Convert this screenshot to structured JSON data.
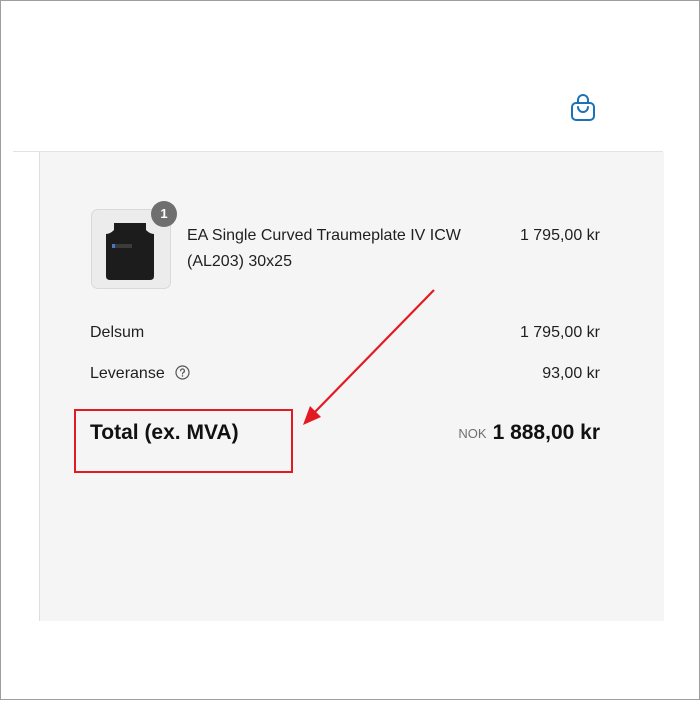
{
  "header": {
    "cart_icon": "shopping-bag-icon",
    "accent_color": "#1a73b8"
  },
  "order_summary": {
    "line_items": [
      {
        "thumbnail_icon": "armor-plate-image",
        "quantity": "1",
        "name": "EA Single Curved Traumeplate IV ICW (AL203) 30x25",
        "price": "1 795,00 kr"
      }
    ],
    "subtotal": {
      "label": "Delsum",
      "value": "1 795,00 kr"
    },
    "shipping": {
      "label": "Leveranse",
      "help_icon": "question-circle-icon",
      "value": "93,00 kr"
    },
    "total": {
      "label": "Total (ex. MVA)",
      "currency": "NOK",
      "value": "1 888,00 kr"
    }
  },
  "annotation": {
    "color": "#e21b23"
  }
}
